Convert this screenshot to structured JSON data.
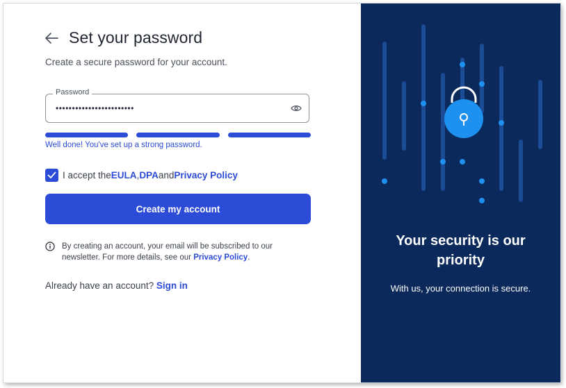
{
  "header": {
    "title": "Set your password",
    "subtitle": "Create a secure password for your account."
  },
  "password_field": {
    "label": "Password",
    "value": "••••••••••••••••••••••••"
  },
  "strength": {
    "segments_filled": 3,
    "segments_total": 3,
    "message": "Well done! You've set up a strong password."
  },
  "consent": {
    "checked": true,
    "prefix": "I accept the ",
    "eula": "EULA",
    "sep1": ", ",
    "dpa": "DPA",
    "sep2": " and ",
    "privacy": "Privacy Policy"
  },
  "cta": {
    "label": "Create my account"
  },
  "notice": {
    "text": "By creating an account, your email will be subscribed to our newsletter. For more details, see our ",
    "link": "Privacy Policy",
    "suffix": "."
  },
  "signin": {
    "text": "Already have an account? ",
    "link": "Sign in"
  },
  "promo": {
    "title": "Your security is our priority",
    "text": "With us, your connection is secure."
  },
  "colors": {
    "accent": "#2c4bd6",
    "panel": "#0b2a5b",
    "art_blue": "#1e90f0"
  },
  "icons": [
    "back-arrow-icon",
    "eye-icon",
    "check-icon",
    "info-icon",
    "padlock-icon"
  ]
}
